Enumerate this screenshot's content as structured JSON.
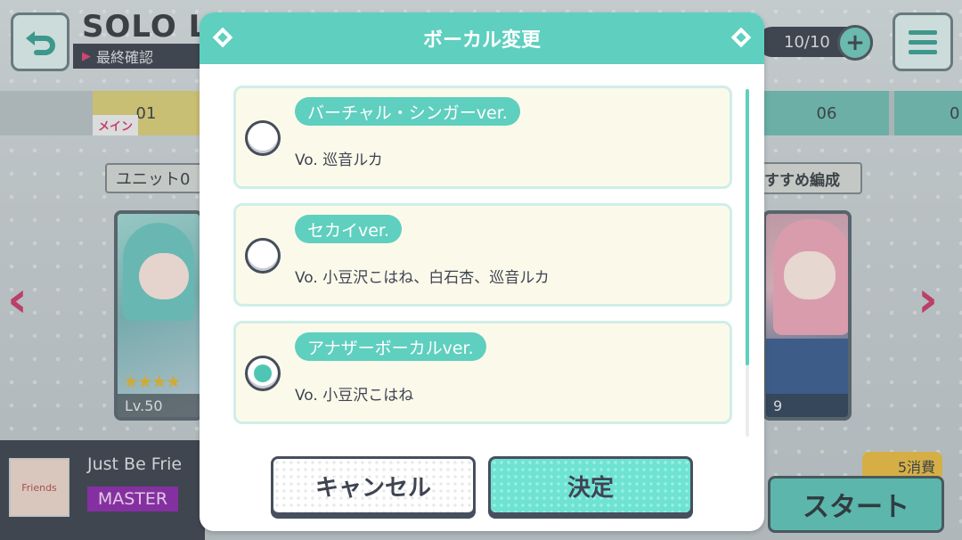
{
  "background": {
    "title": "SOLO L",
    "subtitle": "最終確認",
    "stamina": "10/10",
    "slot_main_number": "01",
    "slot_main_tag": "メイン",
    "slot_06": "06",
    "slot_07": "0",
    "unit_label": "ユニット0",
    "recommend_label": "すすめ編成",
    "card_left_level": "Lv.50",
    "card_right_level": "9",
    "jacket_text": "Friends",
    "song_title": "Just Be Frie",
    "difficulty": "MASTER",
    "consume_badge": "5消費",
    "start_label": "スタート"
  },
  "modal": {
    "title": "ボーカル変更",
    "options": [
      {
        "version": "バーチャル・シンガーver.",
        "vocal": "Vo. 巡音ルカ",
        "selected": false
      },
      {
        "version": "セカイver.",
        "vocal": "Vo. 小豆沢こはね、白石杏、巡音ルカ",
        "selected": false
      },
      {
        "version": "アナザーボーカルver.",
        "vocal": "Vo. 小豆沢こはね",
        "selected": true
      }
    ],
    "cancel_label": "キャンセル",
    "confirm_label": "決定"
  },
  "colors": {
    "accent": "#5fcfbf",
    "option_bg": "#fbfaea",
    "text_dark": "#3f4452",
    "difficulty_master": "#8b2ea8"
  },
  "icons": {
    "back": "back-arrow-icon",
    "menu": "hamburger-menu-icon",
    "stamina_add": "plus-icon",
    "nav_left": "chevron-left-icon",
    "nav_right": "chevron-right-icon"
  }
}
